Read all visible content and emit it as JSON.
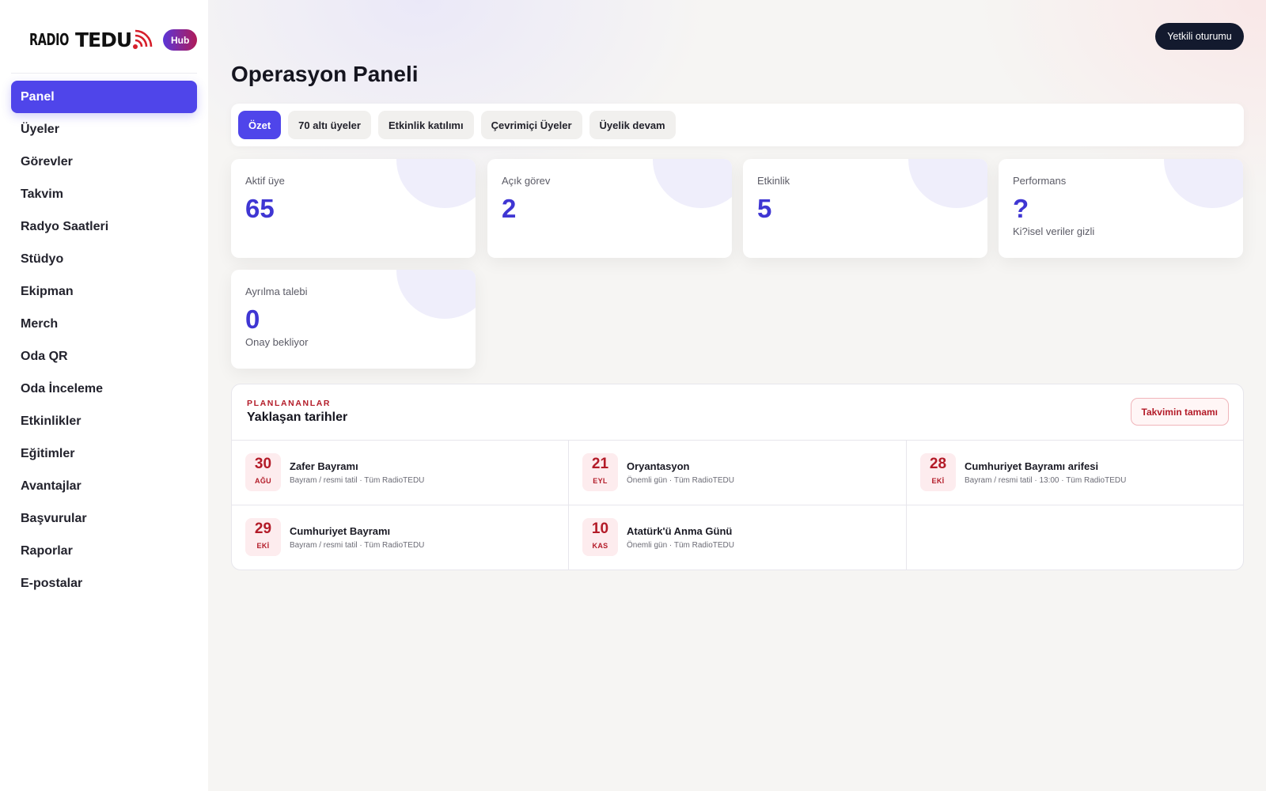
{
  "brand": {
    "logo_text_1": "RADIO",
    "logo_text_2": "TEDU",
    "hub_label": "Hub",
    "accent": "#4f45ea",
    "logo_red": "#d61f2b"
  },
  "sidebar": {
    "items": [
      {
        "label": "Panel",
        "active": true
      },
      {
        "label": "Üyeler"
      },
      {
        "label": "Görevler"
      },
      {
        "label": "Takvim"
      },
      {
        "label": "Radyo Saatleri"
      },
      {
        "label": "Stüdyo"
      },
      {
        "label": "Ekipman"
      },
      {
        "label": "Merch"
      },
      {
        "label": "Oda QR"
      },
      {
        "label": "Oda İnceleme"
      },
      {
        "label": "Etkinlikler"
      },
      {
        "label": "Eğitimler"
      },
      {
        "label": "Avantajlar"
      },
      {
        "label": "Başvurular"
      },
      {
        "label": "Raporlar"
      },
      {
        "label": "E-postalar"
      }
    ]
  },
  "header": {
    "auth_button": "Yetkili oturumu",
    "title": "Operasyon Paneli"
  },
  "tabs": [
    {
      "label": "Özet",
      "active": true
    },
    {
      "label": "70 altı üyeler"
    },
    {
      "label": "Etkinlik katılımı"
    },
    {
      "label": "Çevrimiçi Üyeler"
    },
    {
      "label": "Üyelik devam"
    }
  ],
  "stats": [
    {
      "label": "Aktif üye",
      "value": "65",
      "sub": ""
    },
    {
      "label": "Açık görev",
      "value": "2",
      "sub": ""
    },
    {
      "label": "Etkinlik",
      "value": "5",
      "sub": ""
    },
    {
      "label": "Performans",
      "value": "?",
      "sub": "Ki?isel veriler gizli"
    },
    {
      "label": "Ayrılma talebi",
      "value": "0",
      "sub": "Onay bekliyor"
    }
  ],
  "upcoming": {
    "eyebrow": "PLANLANANLAR",
    "title": "Yaklaşan tarihler",
    "button": "Takvimin tamamı",
    "events": [
      {
        "day": "30",
        "month": "AĞU",
        "title": "Zafer Bayramı",
        "meta": "Bayram / resmi tatil · Tüm RadioTEDU"
      },
      {
        "day": "21",
        "month": "EYL",
        "title": "Oryantasyon",
        "meta": "Önemli gün · Tüm RadioTEDU"
      },
      {
        "day": "28",
        "month": "EKİ",
        "title": "Cumhuriyet Bayramı arifesi",
        "meta": "Bayram / resmi tatil · 13:00 · Tüm RadioTEDU"
      },
      {
        "day": "29",
        "month": "EKİ",
        "title": "Cumhuriyet Bayramı",
        "meta": "Bayram / resmi tatil · Tüm RadioTEDU"
      },
      {
        "day": "10",
        "month": "KAS",
        "title": "Atatürk'ü Anma Günü",
        "meta": "Önemli gün · Tüm RadioTEDU"
      }
    ]
  }
}
